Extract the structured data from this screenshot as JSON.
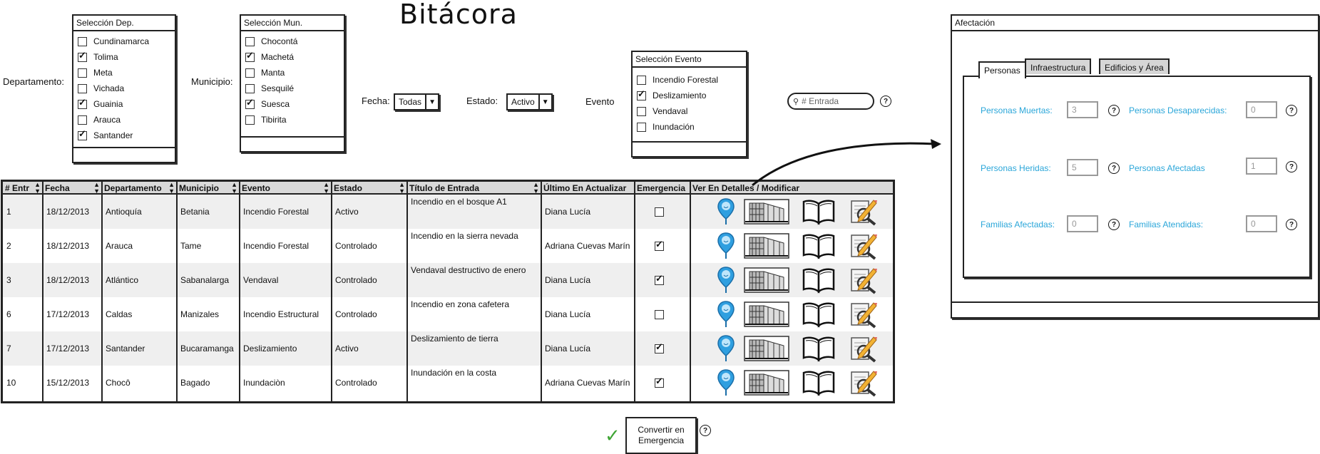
{
  "app": {
    "title": "Bitácora"
  },
  "filters": {
    "departamento_label": "Departamento:",
    "municipio_label": "Municipio:",
    "fecha_label": "Fecha:",
    "estado_label": "Estado:",
    "evento_label": "Evento",
    "fecha_value": "Todas",
    "estado_value": "Activo",
    "search_placeholder": "# Entrada",
    "help": "?"
  },
  "dep_box": {
    "title": "Selección Dep.",
    "items": [
      {
        "label": "Cundinamarca",
        "checked": false
      },
      {
        "label": "Tolima",
        "checked": true
      },
      {
        "label": "Meta",
        "checked": false
      },
      {
        "label": "Vichada",
        "checked": false
      },
      {
        "label": "Guainia",
        "checked": true
      },
      {
        "label": "Arauca",
        "checked": false
      },
      {
        "label": "Santander",
        "checked": true
      }
    ]
  },
  "mun_box": {
    "title": "Selección Mun.",
    "items": [
      {
        "label": "Chocontá",
        "checked": false
      },
      {
        "label": "Machetá",
        "checked": true
      },
      {
        "label": "Manta",
        "checked": false
      },
      {
        "label": "Sesquilé",
        "checked": false
      },
      {
        "label": "Suesca",
        "checked": true
      },
      {
        "label": "Tibirita",
        "checked": false
      }
    ]
  },
  "event_box": {
    "title": "Selección Evento",
    "items": [
      {
        "label": "Incendio Forestal",
        "checked": false
      },
      {
        "label": "Deslizamiento",
        "checked": true
      },
      {
        "label": "Vendaval",
        "checked": false
      },
      {
        "label": "Inundación",
        "checked": false
      }
    ]
  },
  "table": {
    "headers": [
      "# Entr",
      "Fecha",
      "Departamento",
      "Municipio",
      "Evento",
      "Estado",
      "Título de Entrada",
      "Último En Actualizar",
      "Emergencia",
      "Ver En Detalles / Modificar"
    ],
    "rows": [
      {
        "id": "1",
        "fecha": "18/12/2013",
        "departamento": "Antioquía",
        "municipio": "Betania",
        "evento": "Incendio Forestal",
        "estado": "Activo",
        "titulo": "Incendio en el bosque A1",
        "ultimo": "Diana Lucía",
        "emergencia": false
      },
      {
        "id": "2",
        "fecha": "18/12/2013",
        "departamento": "Arauca",
        "municipio": "Tame",
        "evento": "Incendio Forestal",
        "estado": "Controlado",
        "titulo": "Incendio en la sierra nevada",
        "ultimo": "Adriana Cuevas Marín",
        "emergencia": true
      },
      {
        "id": "3",
        "fecha": "18/12/2013",
        "departamento": "Atlántico",
        "municipio": "Sabanalarga",
        "evento": "Vendaval",
        "estado": "Controlado",
        "titulo": "Vendaval destructivo de enero",
        "ultimo": "Diana Lucía",
        "emergencia": true
      },
      {
        "id": "6",
        "fecha": "17/12/2013",
        "departamento": "Caldas",
        "municipio": "Manizales",
        "evento": "Incendio Estructural",
        "estado": "Controlado",
        "titulo": "Incendio en zona cafetera",
        "ultimo": "Diana Lucía",
        "emergencia": false
      },
      {
        "id": "7",
        "fecha": "17/12/2013",
        "departamento": "Santander",
        "municipio": "Bucaramanga",
        "evento": "Deslizamiento",
        "estado": "Activo",
        "titulo": "Deslizamiento de tierra",
        "ultimo": "Diana Lucía",
        "emergencia": true
      },
      {
        "id": "10",
        "fecha": "15/12/2013",
        "departamento": "Chocô",
        "municipio": "Bagado",
        "evento": "Inundaciòn",
        "estado": "Controlado",
        "titulo": "Inundación en la costa",
        "ultimo": "Adriana Cuevas Marín",
        "emergencia": true
      }
    ]
  },
  "convert_button": {
    "label": "Convertir en Emergencia",
    "check": "✓"
  },
  "afectacion": {
    "title": "Afectación",
    "tabs": [
      "Personas",
      "Infraestructura",
      "Edificios y Área"
    ],
    "fields": [
      {
        "label": "Personas Muertas:",
        "value": "3"
      },
      {
        "label": "Personas Desaparecidas:",
        "value": "0"
      },
      {
        "label": "Personas Heridas:",
        "value": "5"
      },
      {
        "label": "Personas Afectadas",
        "value": "1"
      },
      {
        "label": "Familias Afectadas:",
        "value": "0"
      },
      {
        "label": "Familias Atendidas:",
        "value": "0"
      }
    ]
  }
}
